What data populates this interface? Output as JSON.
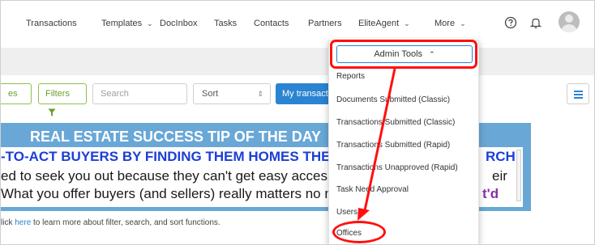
{
  "nav": {
    "items": [
      "Transactions",
      "Templates",
      "DocInbox",
      "Tasks",
      "Contacts",
      "Partners",
      "EliteAgent",
      "More"
    ],
    "icons": [
      "help-circle-icon",
      "bell-icon",
      "avatar"
    ]
  },
  "toolbar": {
    "partial_button": "es",
    "filters_label": "Filters",
    "search_placeholder": "Search",
    "sort_label": "Sort",
    "my_transactions_label": "My transactio"
  },
  "banner": {
    "title": "REAL ESTATE SUCCESS TIP OF THE DAY",
    "line2": "-TO-ACT BUYERS BY FINDING THEM HOMES THE",
    "line2_right": "RCH",
    "line3": "ed to seek you out because they can't get easy acces",
    "line3_right": "eir",
    "line4": "What you offer buyers (and sellers) really matters no m",
    "line4_right": "t'd"
  },
  "help": {
    "prefix": "lick ",
    "link": "here",
    "suffix": " to learn more about filter, search, and sort functions."
  },
  "dropdown": {
    "admin_tools_label": "Admin Tools",
    "items": [
      "Reports",
      "Documents Submitted (Classic)",
      "Transactions Submitted (Classic)",
      "Transactions Submitted (Rapid)",
      "Transactions Unapproved (Rapid)",
      "Task Need Approval",
      "Users",
      "Offices"
    ]
  },
  "colors": {
    "accent_blue": "#2a84d1",
    "highlight_red": "#ff1010",
    "filter_green": "#8bc34a",
    "banner_blue": "#69a7d6"
  }
}
